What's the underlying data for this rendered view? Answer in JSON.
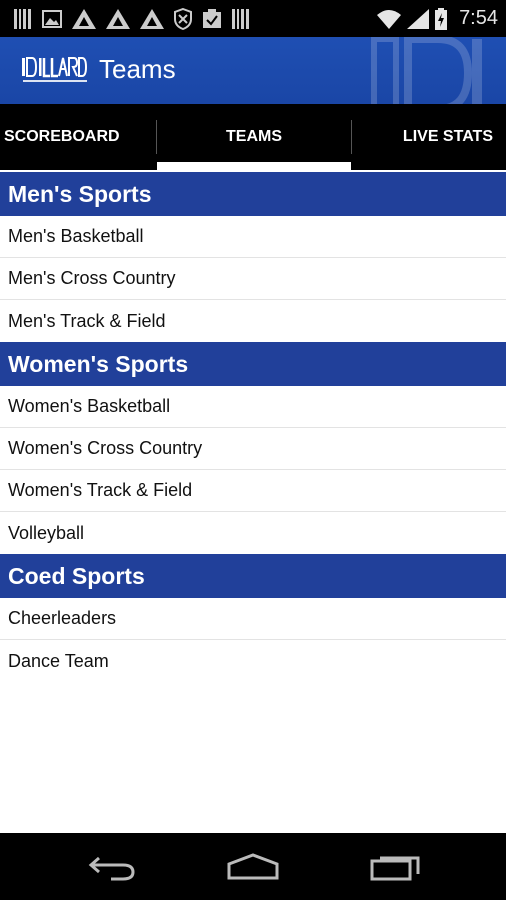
{
  "status_bar": {
    "time": "7:54",
    "left_icons": [
      "barcode-icon",
      "image-icon",
      "triangle-logo-icon",
      "triangle-logo-icon",
      "triangle-logo-icon",
      "shield-x-icon",
      "clipboard-icon",
      "barcode-icon"
    ],
    "right_icons": [
      "wifi-icon",
      "signal-icon",
      "battery-icon"
    ]
  },
  "app_bar": {
    "title": "Teams",
    "logo_icon": "dillard-blue-devils-logo"
  },
  "tabs": [
    {
      "label": "SCOREBOARD",
      "selected": false
    },
    {
      "label": "TEAMS",
      "selected": true
    },
    {
      "label": "LIVE STATS",
      "selected": false
    }
  ],
  "sections": [
    {
      "title": "Men's Sports",
      "items": [
        "Men's Basketball",
        "Men's Cross Country",
        "Men's Track & Field"
      ]
    },
    {
      "title": "Women's Sports",
      "items": [
        "Women's Basketball",
        "Women's Cross Country",
        "Women's Track & Field",
        "Volleyball"
      ]
    },
    {
      "title": "Coed Sports",
      "items": [
        "Cheerleaders",
        "Dance Team"
      ]
    }
  ],
  "nav_bar": {
    "buttons": [
      "back-icon",
      "home-icon",
      "recent-apps-icon"
    ]
  },
  "colors": {
    "app_bar": "#1f4fb3",
    "section_header": "#21409a",
    "tab_bar": "#000000",
    "tab_indicator": "#ffffff"
  }
}
